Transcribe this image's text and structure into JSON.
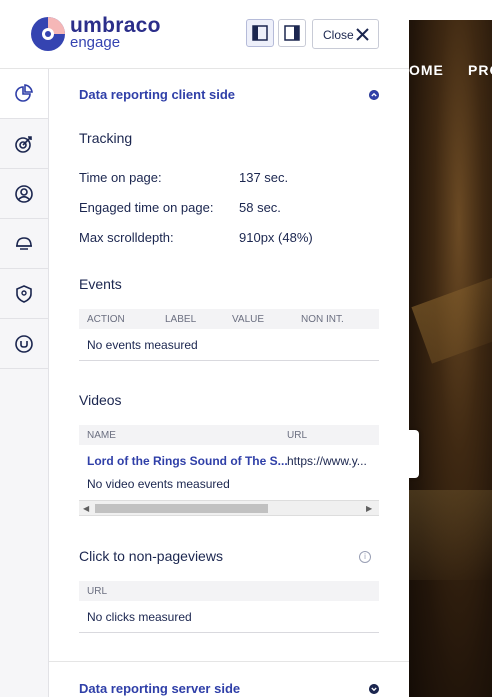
{
  "background": {
    "nav": [
      "OME",
      "PRO"
    ]
  },
  "header": {
    "logo_line1": "umbraco",
    "logo_line2": "engage",
    "close_label": "Close"
  },
  "sidebar": {
    "items": [
      {
        "icon": "pie-chart-icon",
        "active": true
      },
      {
        "icon": "target-icon",
        "active": false
      },
      {
        "icon": "user-circle-icon",
        "active": false
      },
      {
        "icon": "helmet-icon",
        "active": false
      },
      {
        "icon": "location-shield-icon",
        "active": false
      },
      {
        "icon": "umbraco-icon",
        "active": false
      }
    ]
  },
  "client_section": {
    "title": "Data reporting client side",
    "tracking": {
      "heading": "Tracking",
      "rows": [
        {
          "label": "Time on page:",
          "value": "137 sec."
        },
        {
          "label": "Engaged time on page:",
          "value": "58 sec."
        },
        {
          "label": "Max scrolldepth:",
          "value": "910px (48%)"
        }
      ]
    },
    "events": {
      "heading": "Events",
      "columns": [
        "ACTION",
        "LABEL",
        "VALUE",
        "NON INT."
      ],
      "empty": "No events measured"
    },
    "videos": {
      "heading": "Videos",
      "columns": [
        "NAME",
        "URL"
      ],
      "row": {
        "name": "Lord of the Rings Sound of The S...",
        "url": "https://www.y..."
      },
      "empty": "No video events measured",
      "scroll_fraction": 0.62
    },
    "clicks": {
      "heading": "Click to non-pageviews",
      "columns": [
        "URL"
      ],
      "empty": "No clicks measured",
      "info_glyph": "i"
    }
  },
  "server_section": {
    "title": "Data reporting server side"
  }
}
